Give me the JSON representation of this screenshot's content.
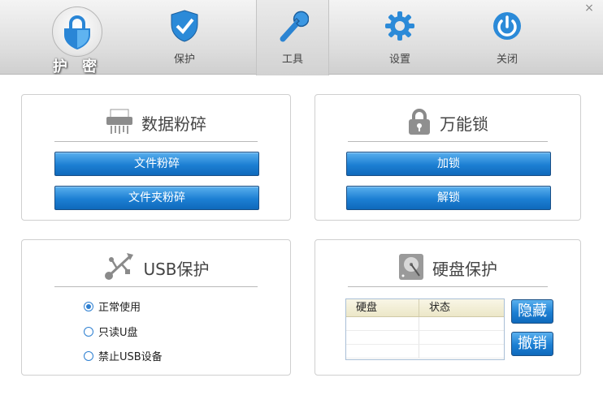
{
  "window": {
    "close_symbol": "×"
  },
  "brand": {
    "name": "护 密",
    "icon": "shield-lock-icon"
  },
  "tabs": [
    {
      "label": "保护",
      "icon": "shield-check-icon"
    },
    {
      "label": "工具",
      "icon": "wrench-icon",
      "active": true
    },
    {
      "label": "设置",
      "icon": "gear-icon"
    },
    {
      "label": "关闭",
      "icon": "power-icon"
    }
  ],
  "shredder": {
    "title": "数据粉碎",
    "icon": "shredder-icon",
    "file_button": "文件粉碎",
    "folder_button": "文件夹粉碎"
  },
  "lock": {
    "title": "万能锁",
    "icon": "padlock-icon",
    "lock_button": "加锁",
    "unlock_button": "解锁"
  },
  "usb": {
    "title": "USB保护",
    "icon": "usb-icon",
    "options": [
      {
        "label": "正常使用",
        "checked": true
      },
      {
        "label": "只读U盘",
        "checked": false
      },
      {
        "label": "禁止USB设备",
        "checked": false
      }
    ]
  },
  "disk": {
    "title": "硬盘保护",
    "icon": "hard-disk-icon",
    "columns": [
      "硬盘",
      "状态"
    ],
    "hide_button": "隐藏",
    "cancel_button": "撤销"
  },
  "colors": {
    "button_blue": "#1c7fd3",
    "accent_blue": "#2d7fd1",
    "toolbar_gray": "#dcdcdc"
  }
}
